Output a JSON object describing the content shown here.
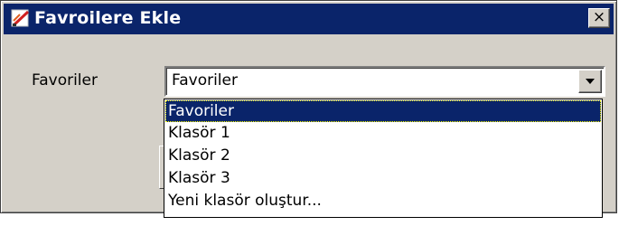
{
  "window": {
    "title": "Favroilere Ekle",
    "close_symbol": "×",
    "icon": "favorites-app-icon"
  },
  "form": {
    "label": "Favoriler",
    "combo_value": "Favoriler"
  },
  "dropdown": {
    "options": [
      "Favoriler",
      "Klasör 1",
      "Klasör 2",
      "Klasör 3",
      "Yeni klasör oluştur..."
    ],
    "selected_index": 0
  },
  "colors": {
    "titlebar": "#0a246a",
    "window_face": "#d4d0c8",
    "selection": "#0a246a"
  }
}
